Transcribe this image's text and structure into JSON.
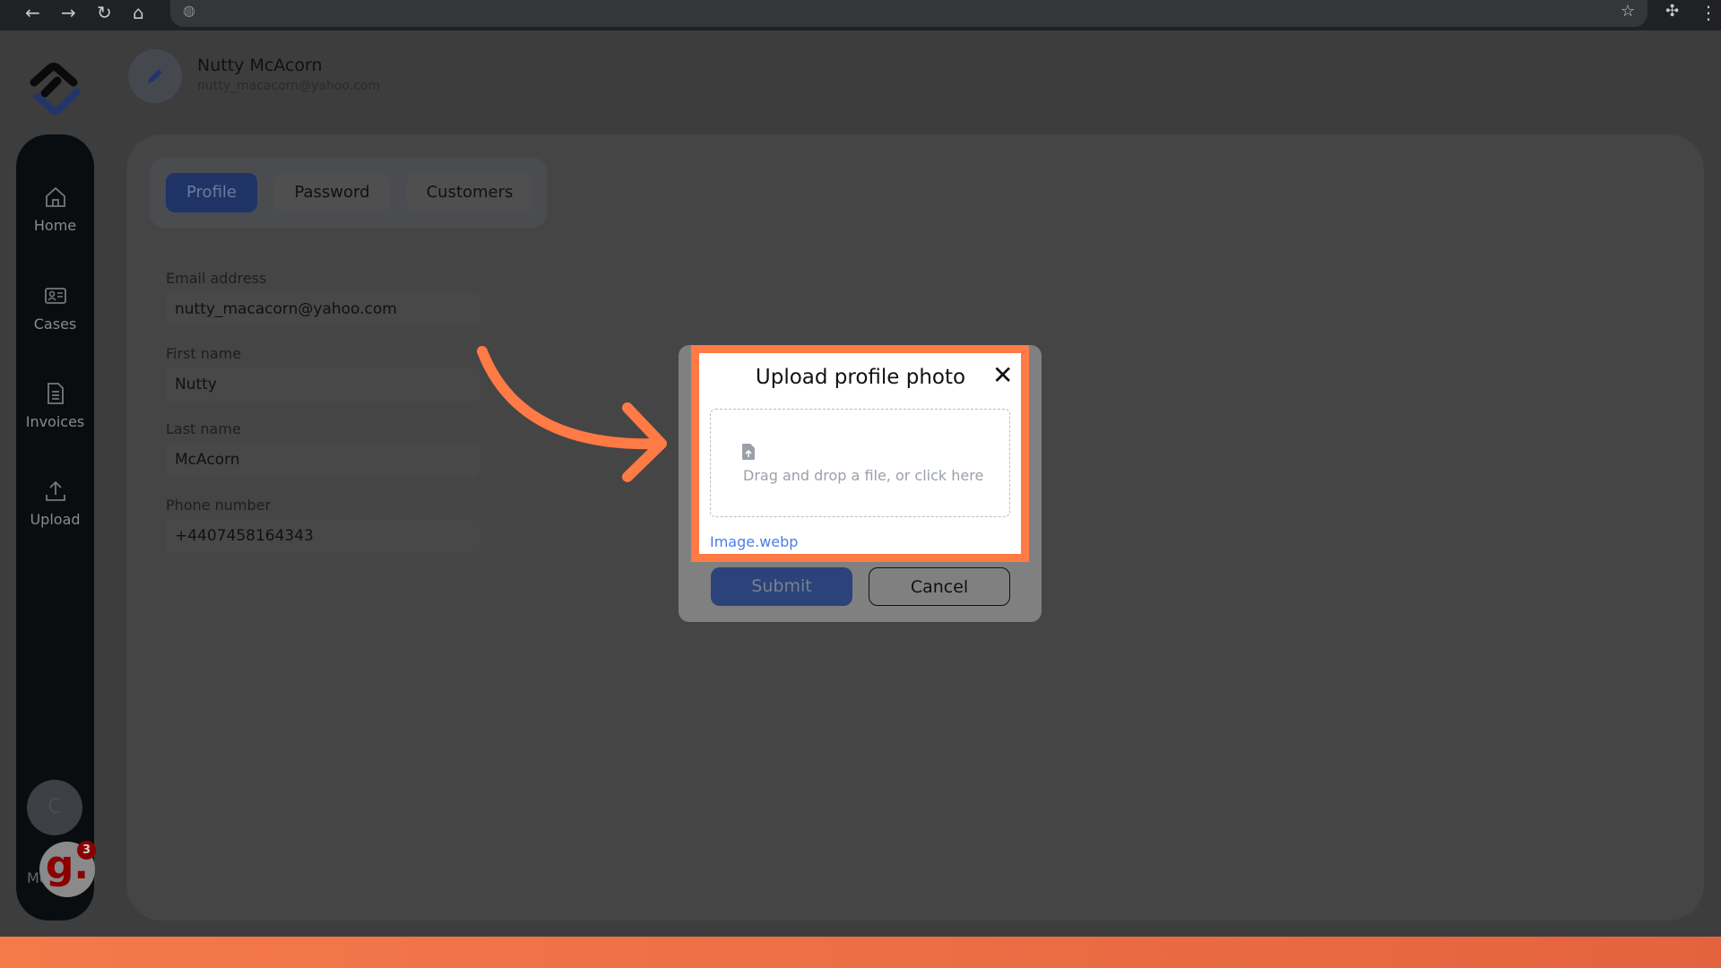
{
  "browser": {
    "icons": [
      "back-icon",
      "forward-icon",
      "reload-icon",
      "home-icon",
      "site-info-icon",
      "bookmark-star-icon",
      "extensions-icon",
      "menu-icon"
    ]
  },
  "header": {
    "name": "Nutty McAcorn",
    "email": "nutty_macacorn@yahoo.com"
  },
  "sidebar": {
    "items": [
      {
        "label": "Home",
        "icon": "home-icon"
      },
      {
        "label": "Cases",
        "icon": "id-card-icon"
      },
      {
        "label": "Invoices",
        "icon": "document-icon"
      },
      {
        "label": "Upload",
        "icon": "upload-icon"
      }
    ],
    "avatar_initial": "C",
    "bottom_label": "Mo"
  },
  "widget": {
    "letter": "g.",
    "badge": "3"
  },
  "tabs": [
    {
      "label": "Profile",
      "active": true
    },
    {
      "label": "Password"
    },
    {
      "label": "Customers"
    }
  ],
  "form": {
    "fields": [
      {
        "label": "Email address",
        "value": "nutty_macacorn@yahoo.com"
      },
      {
        "label": "First name",
        "value": "Nutty"
      },
      {
        "label": "Last name",
        "value": "McAcorn"
      },
      {
        "label": "Phone number",
        "value": "+4407458164343"
      }
    ]
  },
  "modal": {
    "title": "Upload profile photo",
    "dropzone_text": "Drag and drop a file, or click here",
    "file_name": "Image.webp",
    "submit": "Submit",
    "cancel": "Cancel"
  },
  "colors": {
    "accent": "#ff7a45",
    "primary": "#2b437a",
    "link": "#4a7ee8"
  }
}
